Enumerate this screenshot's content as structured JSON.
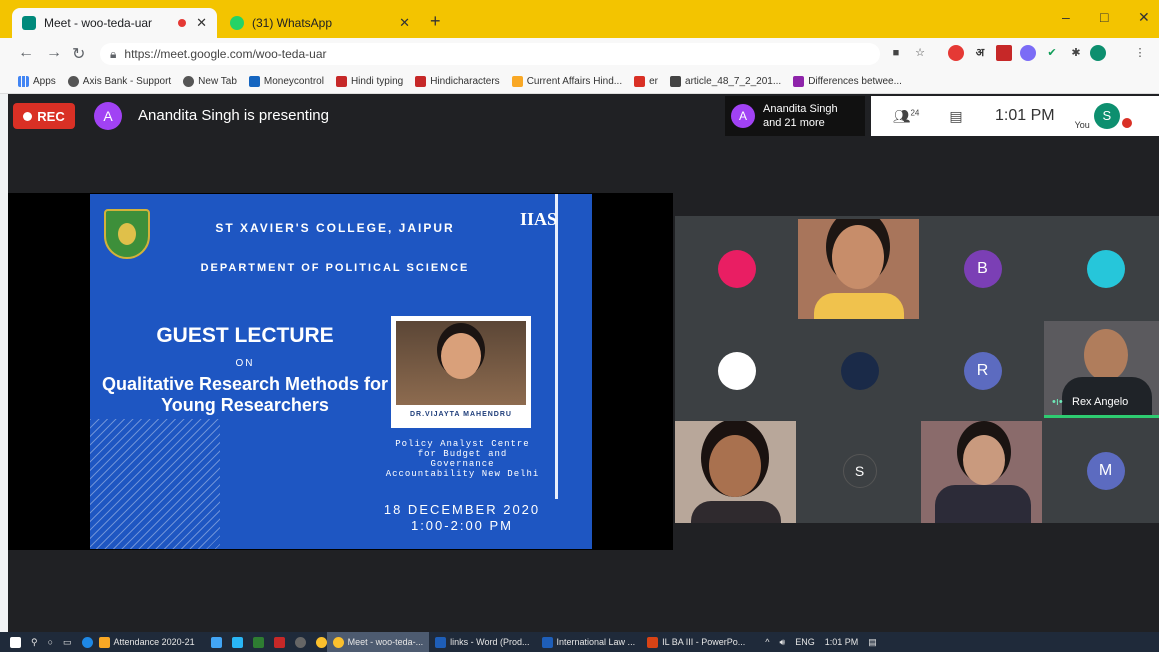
{
  "browser": {
    "tabs": [
      {
        "title": "Meet - woo-teda-uar",
        "active": true
      },
      {
        "title": "(31) WhatsApp",
        "active": false
      }
    ],
    "new_tab": "+",
    "window_controls": [
      "–",
      "□",
      "✕"
    ],
    "url": "https://meet.google.com/woo-teda-uar",
    "bookmarks": [
      "Apps",
      "Axis Bank - Support",
      "New Tab",
      "Moneycontrol",
      "Hindi typing",
      "Hindicharacters",
      "Current Affairs Hind...",
      "er",
      "article_48_7_2_201...",
      "Differences betwee..."
    ]
  },
  "meet": {
    "rec_label": "REC",
    "presenter_initial": "A",
    "presenting_text": "Anandita Singh is presenting",
    "people_initial": "A",
    "people_line1": "Anandita Singh",
    "people_line2": "and 21 more",
    "people_count": "24",
    "time": "1:01 PM",
    "you_label": "You",
    "self_initial": "S"
  },
  "slide": {
    "college": "ST XAVIER'S COLLEGE, JAIPUR",
    "department": "DEPARTMENT OF POLITICAL SCIENCE",
    "logo_text": "IIAS",
    "heading": "GUEST LECTURE",
    "on": "ON",
    "topic": "Qualitative Research Methods for Young Researchers",
    "speaker": "DR.VIJAYTA MAHENDRU",
    "role": "Policy Analyst Centre for Budget and Governance Accountability New Delhi",
    "date": "18 DECEMBER 2020",
    "time": "1:00-2:00 PM"
  },
  "participants": {
    "b": "B",
    "r": "R",
    "s": "S",
    "m": "M",
    "rex_name": "Rex Angelo"
  },
  "taskbar": {
    "apps": [
      "Attendance 2020-21",
      "Meet - woo-teda-...",
      "links - Word (Prod...",
      "International Law ...",
      "IL BA III - PowerPo..."
    ],
    "lang": "ENG",
    "clock": "1:01 PM"
  },
  "colors": {
    "tabbar": "#f3c400",
    "rec": "#d93025",
    "slide": "#1e56c2"
  }
}
